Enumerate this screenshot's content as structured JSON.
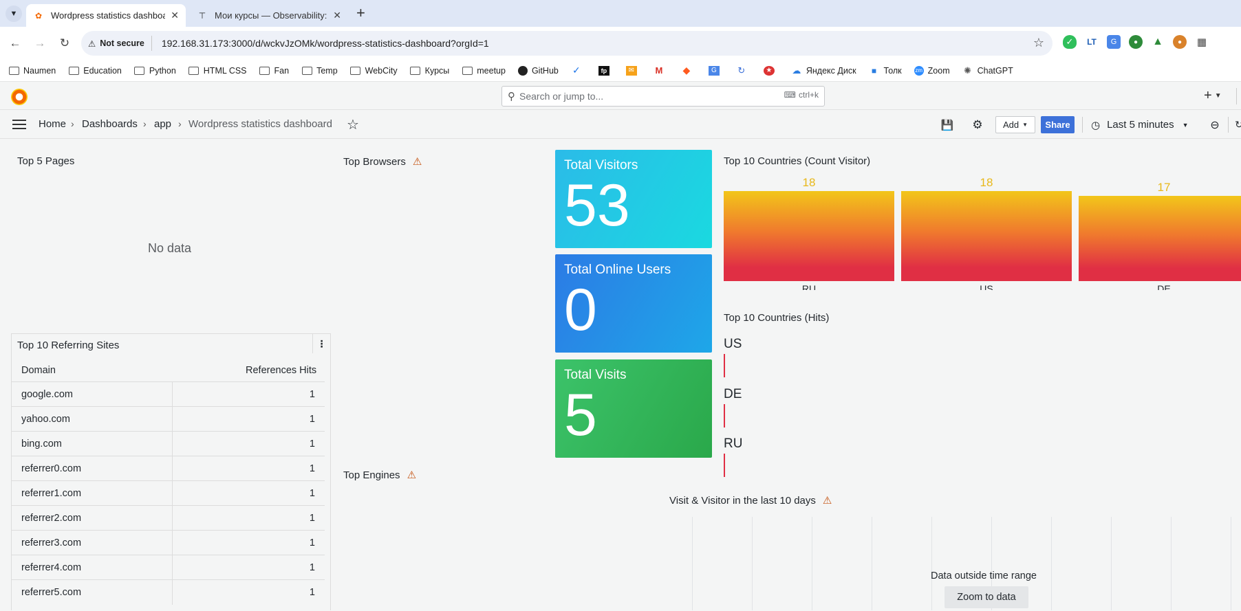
{
  "browser": {
    "tabs": [
      {
        "title": "Wordpress statistics dashboard",
        "active": true
      },
      {
        "title": "Мои курсы — Observability: мо",
        "active": false
      }
    ],
    "new_tab": "+",
    "address": {
      "security": "Not secure",
      "url": "192.168.31.173:3000/d/wckvJzOMk/wordpress-statistics-dashboard?orgId=1"
    },
    "bookmarks": [
      "Naumen",
      "Education",
      "Python",
      "HTML CSS",
      "Fan",
      "Temp",
      "WebCity",
      "Курсы",
      "meetup",
      "GitHub",
      "Яндекс Диск",
      "Толк",
      "Zoom",
      "ChatGPT"
    ]
  },
  "grafana": {
    "search_placeholder": "Search or jump to...",
    "search_shortcut": "ctrl+k",
    "plus": "+",
    "breadcrumb": [
      "Home",
      "Dashboards",
      "app",
      "Wordpress statistics dashboard"
    ],
    "toolbar": {
      "add": "Add",
      "share": "Share",
      "time_range": "Last 5 minutes"
    }
  },
  "panels": {
    "top_pages": {
      "title": "Top 5 Pages",
      "empty": "No data"
    },
    "top_browsers": {
      "title": "Top Browsers"
    },
    "top_engines": {
      "title": "Top Engines"
    },
    "stats": [
      {
        "label": "Total Visitors",
        "value": "53"
      },
      {
        "label": "Total Online Users",
        "value": "0"
      },
      {
        "label": "Total Visits",
        "value": "5"
      }
    ],
    "countries_count": {
      "title": "Top 10 Countries (Count Visitor)"
    },
    "countries_hits": {
      "title": "Top 10 Countries (Hits)",
      "labels": [
        "US",
        "DE",
        "RU"
      ]
    },
    "referring": {
      "title": "Top 10 Referring Sites",
      "headers": [
        "Domain",
        "References Hits"
      ],
      "rows": [
        {
          "domain": "google.com",
          "hits": "1"
        },
        {
          "domain": "yahoo.com",
          "hits": "1"
        },
        {
          "domain": "bing.com",
          "hits": "1"
        },
        {
          "domain": "referrer0.com",
          "hits": "1"
        },
        {
          "domain": "referrer1.com",
          "hits": "1"
        },
        {
          "domain": "referrer2.com",
          "hits": "1"
        },
        {
          "domain": "referrer3.com",
          "hits": "1"
        },
        {
          "domain": "referrer4.com",
          "hits": "1"
        },
        {
          "domain": "referrer5.com",
          "hits": "1"
        }
      ]
    },
    "visits_10days": {
      "title": "Visit & Visitor in the last 10 days",
      "message": "Data outside time range",
      "zoom_button": "Zoom to data"
    }
  },
  "chart_data": {
    "type": "bar",
    "title": "Top 10 Countries (Count Visitor)",
    "categories": [
      "RU",
      "US",
      "DE"
    ],
    "values": [
      18,
      18,
      17
    ]
  },
  "colors": {
    "visitors_gradient": [
      "#2bbbe8",
      "#1ad9e0"
    ],
    "online_gradient": [
      "#2c7be5",
      "#1ea7e8"
    ],
    "visits_gradient": [
      "#3cc36a",
      "#2aa84a"
    ],
    "share": "#3d71d9",
    "warning": "#c4500d"
  }
}
